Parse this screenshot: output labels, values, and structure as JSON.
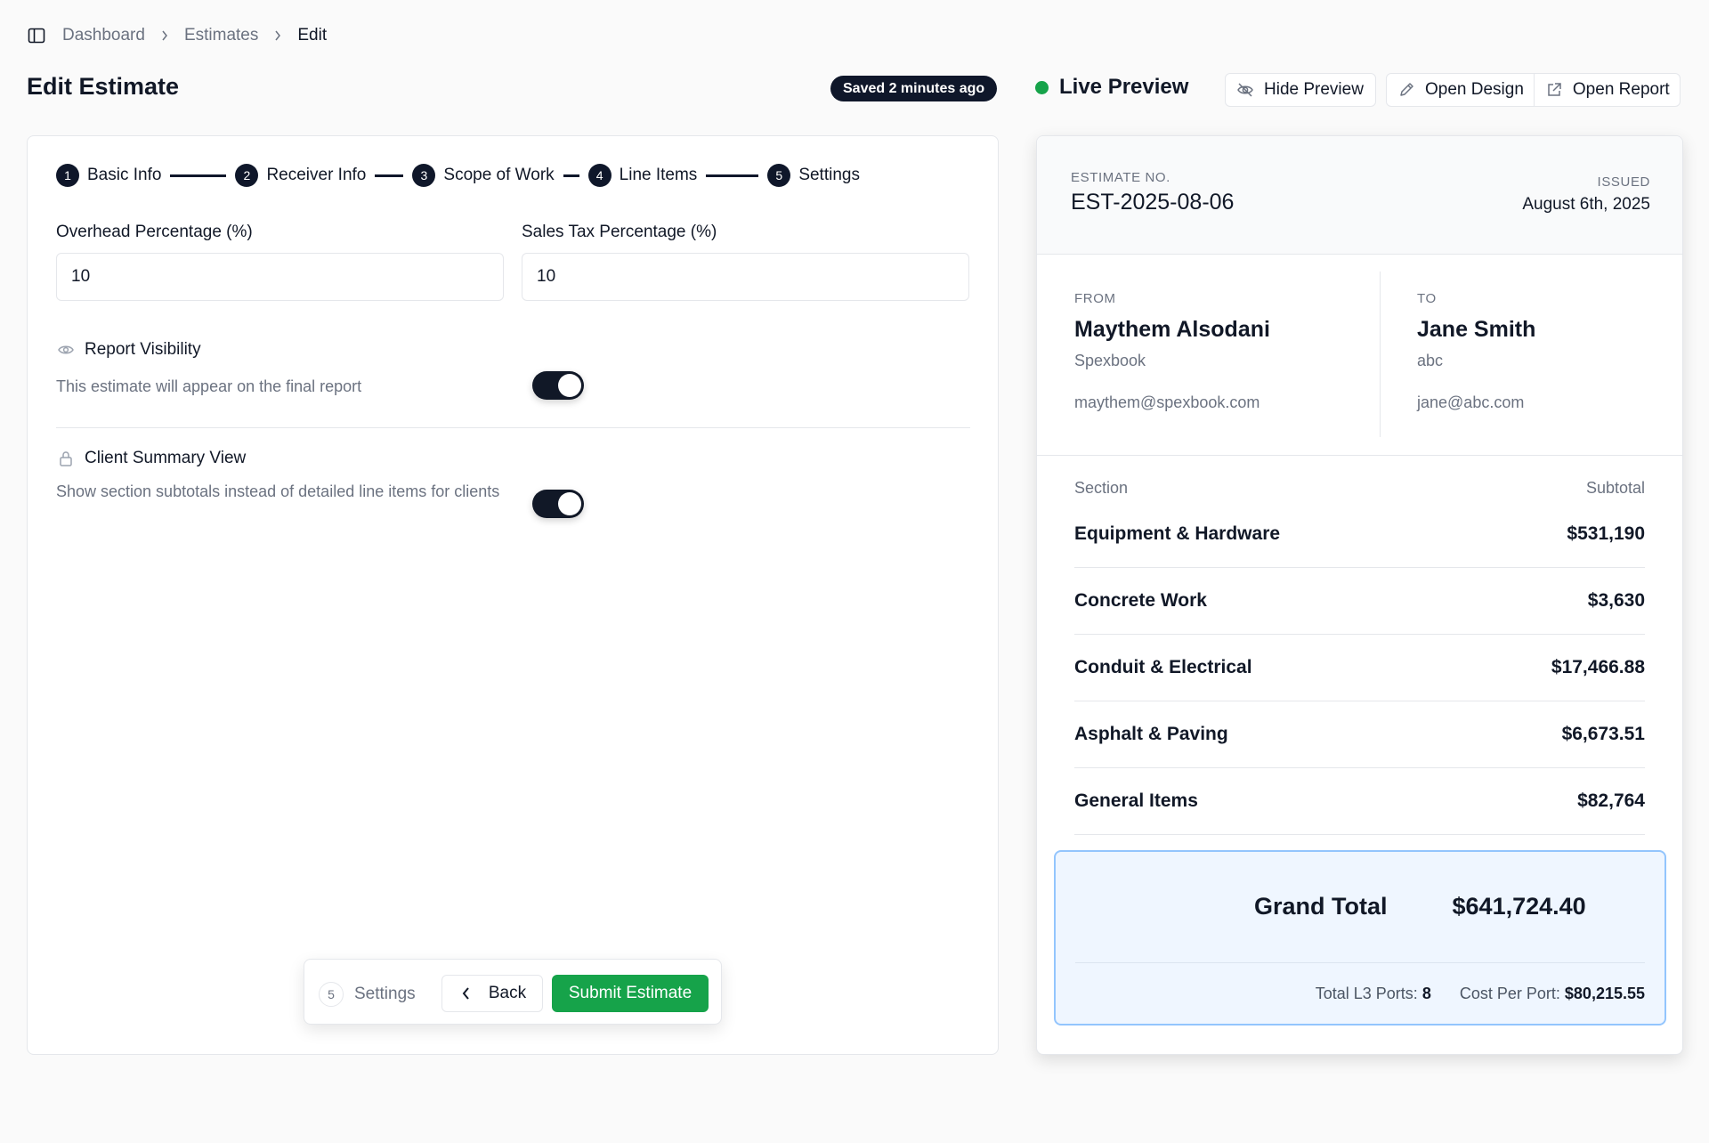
{
  "breadcrumb": [
    "Dashboard",
    "Estimates",
    "Edit"
  ],
  "page": {
    "title": "Edit Estimate",
    "saved_status": "Saved 2 minutes ago"
  },
  "preview_header": {
    "live_label": "Live Preview",
    "hide_preview": "Hide Preview",
    "open_design": "Open Design",
    "open_report": "Open Report",
    "live_color": "#16a34a"
  },
  "stepper": [
    {
      "num": "1",
      "label": "Basic Info"
    },
    {
      "num": "2",
      "label": "Receiver Info"
    },
    {
      "num": "3",
      "label": "Scope of Work"
    },
    {
      "num": "4",
      "label": "Line Items"
    },
    {
      "num": "5",
      "label": "Settings"
    }
  ],
  "form": {
    "overhead_label": "Overhead Percentage (%)",
    "overhead_value": "10",
    "tax_label": "Sales Tax Percentage (%)",
    "tax_value": "10"
  },
  "options": {
    "report_visibility": {
      "title": "Report Visibility",
      "description": "This estimate will appear on the final report",
      "enabled": true
    },
    "client_summary": {
      "title": "Client Summary View",
      "description": "Show section subtotals instead of detailed line items for clients",
      "enabled": true
    }
  },
  "action_bar": {
    "step_num": "5",
    "step_label": "Settings",
    "back": "Back",
    "submit": "Submit Estimate"
  },
  "estimate": {
    "no_label": "ESTIMATE NO.",
    "no": "EST-2025-08-06",
    "issued_label": "ISSUED",
    "issued": "August 6th, 2025",
    "from": {
      "label": "FROM",
      "name": "Maythem Alsodani",
      "org": "Spexbook",
      "email": "maythem@spexbook.com"
    },
    "to": {
      "label": "TO",
      "name": "Jane Smith",
      "org": "abc",
      "email": "jane@abc.com"
    },
    "table_headers": {
      "section": "Section",
      "subtotal": "Subtotal"
    },
    "sections": [
      {
        "name": "Equipment & Hardware",
        "subtotal": "$531,190"
      },
      {
        "name": "Concrete Work",
        "subtotal": "$3,630"
      },
      {
        "name": "Conduit & Electrical",
        "subtotal": "$17,466.88"
      },
      {
        "name": "Asphalt & Paving",
        "subtotal": "$6,673.51"
      },
      {
        "name": "General Items",
        "subtotal": "$82,764"
      }
    ],
    "grand_total_label": "Grand Total",
    "grand_total": "$641,724.40",
    "ports_label": "Total L3 Ports:",
    "ports_value": "8",
    "cost_per_port_label": "Cost Per Port:",
    "cost_per_port_value": "$80,215.55"
  }
}
